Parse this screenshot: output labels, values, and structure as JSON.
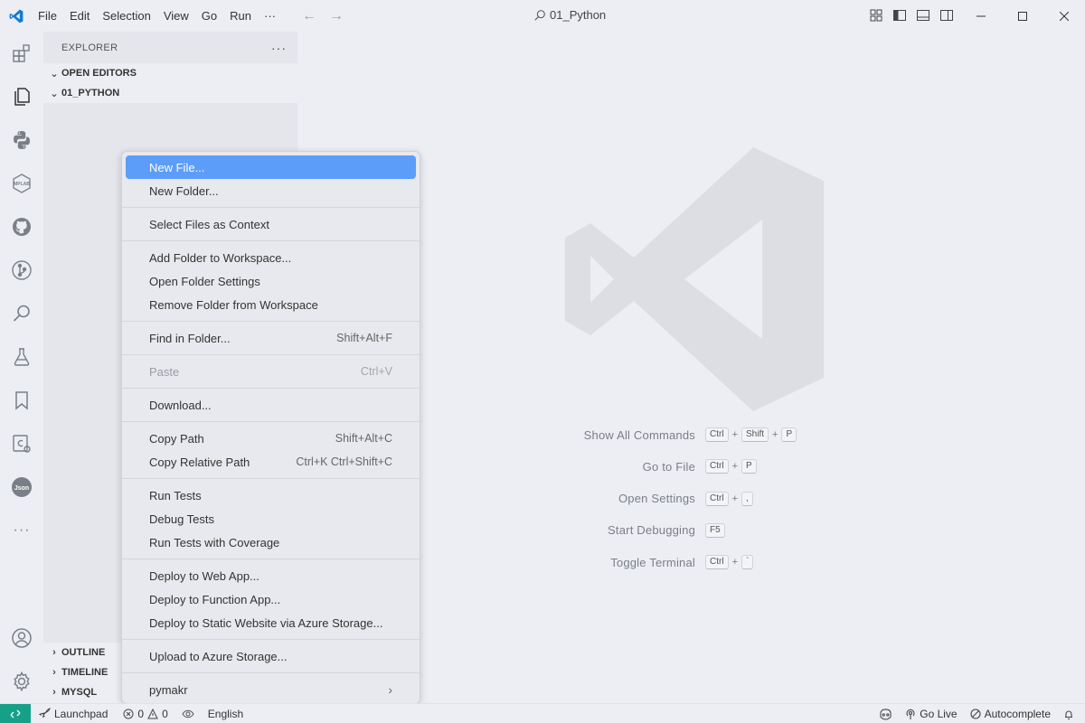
{
  "titlebar": {
    "menus": [
      "File",
      "Edit",
      "Selection",
      "View",
      "Go",
      "Run",
      "···"
    ],
    "search_text": "01_Python",
    "accent": "#0e7bd6"
  },
  "sidebar": {
    "header": "EXPLORER",
    "more": "···",
    "open_editors": "OPEN EDITORS",
    "folder": "01_PYTHON",
    "outline": "OUTLINE",
    "timeline": "TIMELINE",
    "mysql": "MYSQL"
  },
  "activity_icons": [
    "extensions-icon",
    "explorer-icon",
    "python-icon",
    "mplab-icon",
    "github-icon",
    "source-control-icon",
    "search-icon",
    "testing-icon",
    "bookmark-icon",
    "csharp-icon",
    "json-icon",
    "more-icon",
    "account-icon",
    "settings-gear-icon"
  ],
  "activity_labels": {
    "mplab": "MPLAB",
    "json": "Json",
    "more": "···"
  },
  "editor": {
    "shortcuts": [
      {
        "label": "Show All Commands",
        "keys": [
          "Ctrl",
          "Shift",
          "P"
        ]
      },
      {
        "label": "Go to File",
        "keys": [
          "Ctrl",
          "P"
        ]
      },
      {
        "label": "Open Settings",
        "keys": [
          "Ctrl",
          ","
        ]
      },
      {
        "label": "Start Debugging",
        "keys": [
          "F5"
        ]
      },
      {
        "label": "Toggle Terminal",
        "keys": [
          "Ctrl",
          "`"
        ]
      }
    ]
  },
  "context_menu": {
    "groups": [
      [
        {
          "label": "New File...",
          "active": true
        },
        {
          "label": "New Folder..."
        }
      ],
      [
        {
          "label": "Select Files as Context"
        }
      ],
      [
        {
          "label": "Add Folder to Workspace..."
        },
        {
          "label": "Open Folder Settings"
        },
        {
          "label": "Remove Folder from Workspace"
        }
      ],
      [
        {
          "label": "Find in Folder...",
          "key": "Shift+Alt+F"
        }
      ],
      [
        {
          "label": "Paste",
          "key": "Ctrl+V",
          "disabled": true
        }
      ],
      [
        {
          "label": "Download..."
        }
      ],
      [
        {
          "label": "Copy Path",
          "key": "Shift+Alt+C"
        },
        {
          "label": "Copy Relative Path",
          "key": "Ctrl+K Ctrl+Shift+C"
        }
      ],
      [
        {
          "label": "Run Tests"
        },
        {
          "label": "Debug Tests"
        },
        {
          "label": "Run Tests with Coverage"
        }
      ],
      [
        {
          "label": "Deploy to Web App..."
        },
        {
          "label": "Deploy to Function App..."
        },
        {
          "label": "Deploy to Static Website via Azure Storage..."
        }
      ],
      [
        {
          "label": "Upload to Azure Storage..."
        }
      ],
      [
        {
          "label": "pymakr",
          "submenu": true
        }
      ]
    ]
  },
  "statusbar": {
    "remote_color": "#16a08a",
    "launchpad": "Launchpad",
    "errors": "0",
    "warnings": "0",
    "language": "English",
    "go_live": "Go Live",
    "autocomplete": "Autocomplete"
  }
}
